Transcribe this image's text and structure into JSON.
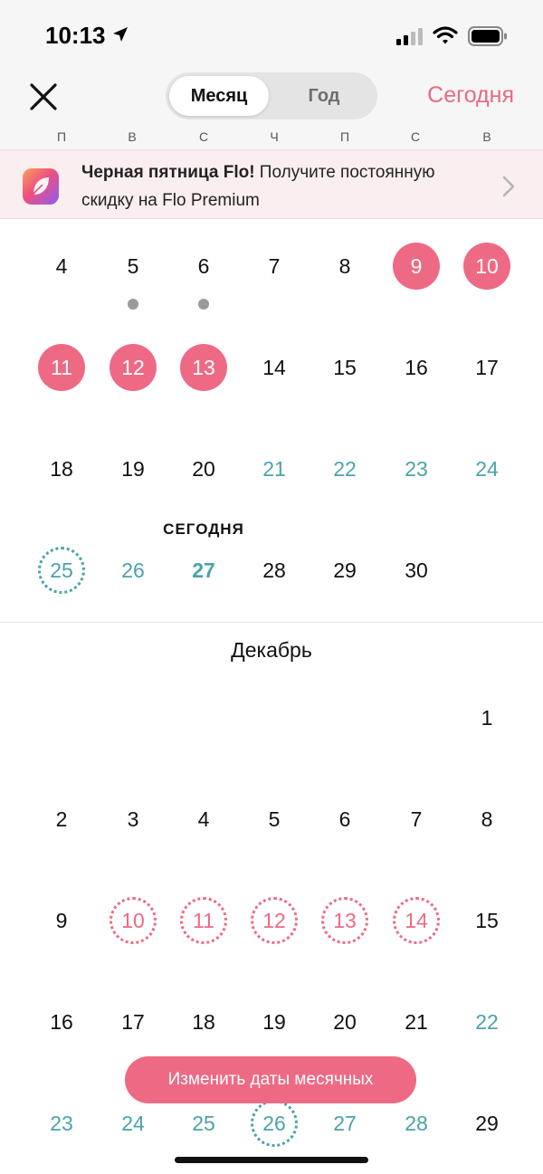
{
  "status_bar": {
    "time": "10:13"
  },
  "header": {
    "view_toggle": {
      "month": "Месяц",
      "year": "Год"
    },
    "today_button": "Сегодня",
    "weekdays": [
      "П",
      "В",
      "С",
      "Ч",
      "П",
      "С",
      "В"
    ]
  },
  "banner": {
    "title": "Черная пятница Flo!",
    "text": " Получите постоянную скидку на Flo Premium"
  },
  "november": {
    "weeks": [
      [
        "4",
        "5",
        "6",
        "7",
        "8",
        "9",
        "10"
      ],
      [
        "11",
        "12",
        "13",
        "14",
        "15",
        "16",
        "17"
      ],
      [
        "18",
        "19",
        "20",
        "21",
        "22",
        "23",
        "24"
      ],
      [
        "25",
        "26",
        "27",
        "28",
        "29",
        "30"
      ]
    ],
    "today_label": "СЕГОДНЯ"
  },
  "december": {
    "title": "Декабрь",
    "weeks": [
      [
        "1"
      ],
      [
        "2",
        "3",
        "4",
        "5",
        "6",
        "7",
        "8"
      ],
      [
        "9",
        "10",
        "11",
        "12",
        "13",
        "14",
        "15"
      ],
      [
        "16",
        "17",
        "18",
        "19",
        "20",
        "21",
        "22"
      ],
      [
        "23",
        "24",
        "25",
        "26",
        "27",
        "28",
        "29"
      ]
    ]
  },
  "actions": {
    "change_period_dates": "Изменить даты месячных"
  },
  "colors": {
    "accent": "#ee6a84",
    "fertile": "#4aa3aa",
    "banner_bg": "#fbeef0"
  },
  "icons": [
    "close-icon",
    "location-arrow-icon",
    "cellular-signal-icon",
    "wifi-icon",
    "battery-icon",
    "flo-app-icon",
    "chevron-right-icon"
  ]
}
